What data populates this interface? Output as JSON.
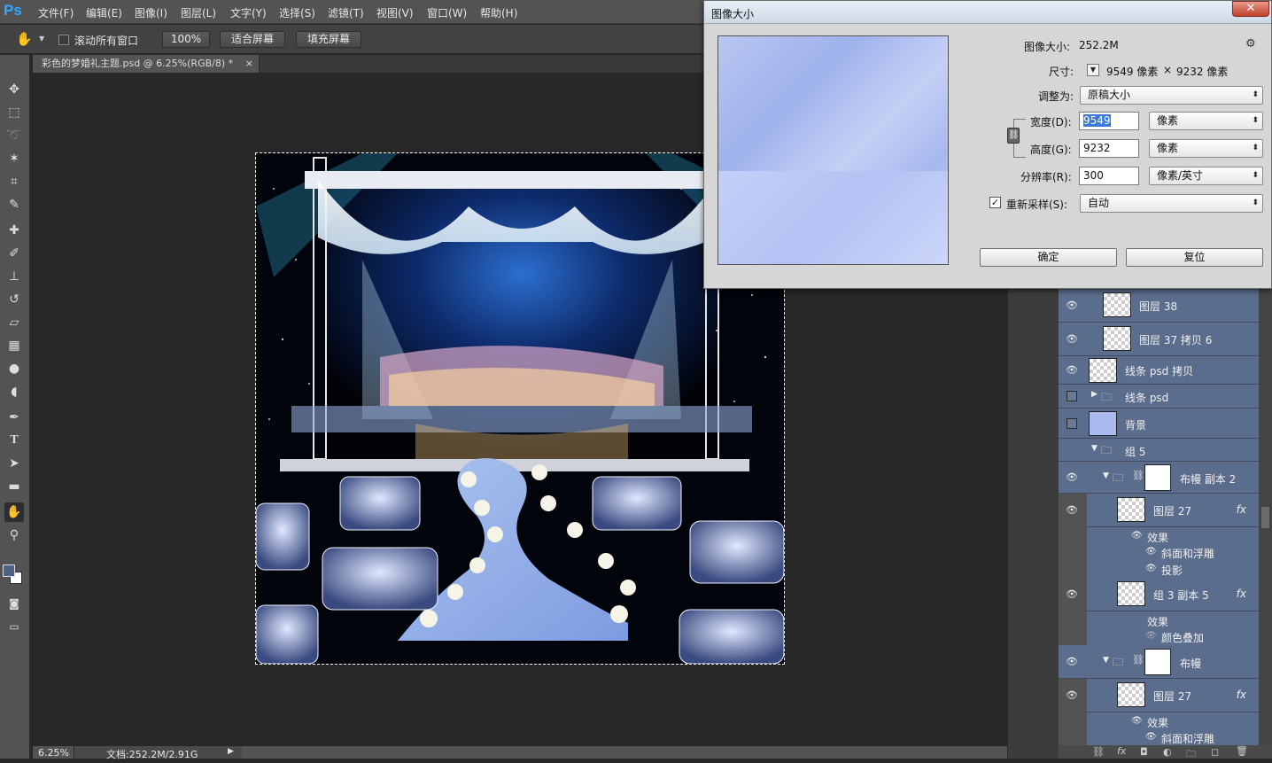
{
  "app": {
    "logo": "Ps",
    "menus": [
      "文件(F)",
      "编辑(E)",
      "图像(I)",
      "图层(L)",
      "文字(Y)",
      "选择(S)",
      "滤镜(T)",
      "视图(V)",
      "窗口(W)",
      "帮助(H)"
    ]
  },
  "options": {
    "scroll_all_label": "滚动所有窗口",
    "zoom_100": "100%",
    "fit_screen": "适合屏幕",
    "fill_screen": "填充屏幕"
  },
  "document": {
    "tab_title": "彩色的梦婚礼主题.psd @ 6.25%(RGB/8) *",
    "tab_close": "×"
  },
  "status": {
    "zoom": "6.25%",
    "doc_info": "文档:252.2M/2.91G"
  },
  "dialog": {
    "title": "图像大小",
    "close": "✕",
    "image_size_label": "图像大小:",
    "image_size_value": "252.2M",
    "dimensions_label": "尺寸:",
    "dim_width": "9549 像素",
    "dim_x": "×",
    "dim_height": "9232 像素",
    "fit_to_label": "调整为:",
    "fit_to_value": "原稿大小",
    "width_label": "宽度(D):",
    "width_value": "9549",
    "width_unit": "像素",
    "height_label": "高度(G):",
    "height_value": "9232",
    "height_unit": "像素",
    "resolution_label": "分辨率(R):",
    "resolution_value": "300",
    "resolution_unit": "像素/英寸",
    "resample_label": "重新采样(S):",
    "resample_checked": true,
    "resample_value": "自动",
    "ok": "确定",
    "reset": "复位"
  },
  "layers": [
    {
      "name": "图层 38"
    },
    {
      "name": "图层 37 拷贝 6"
    },
    {
      "name": "线条  psd 拷贝"
    },
    {
      "name": "线条  psd"
    },
    {
      "name": "背景"
    },
    {
      "name": "组 5"
    },
    {
      "name": "布幔 副本 2"
    },
    {
      "name": "图层 27",
      "fx": "fx"
    },
    {
      "effects": "效果",
      "items": [
        "斜面和浮雕",
        "投影"
      ]
    },
    {
      "name": "组 3 副本 5",
      "fx": "fx"
    },
    {
      "effects": "效果",
      "items": [
        "颜色叠加"
      ]
    },
    {
      "name": "布幔"
    },
    {
      "name": "图层 27",
      "fx": "fx"
    },
    {
      "effects": "效果",
      "items": [
        "斜面和浮雕"
      ]
    }
  ]
}
